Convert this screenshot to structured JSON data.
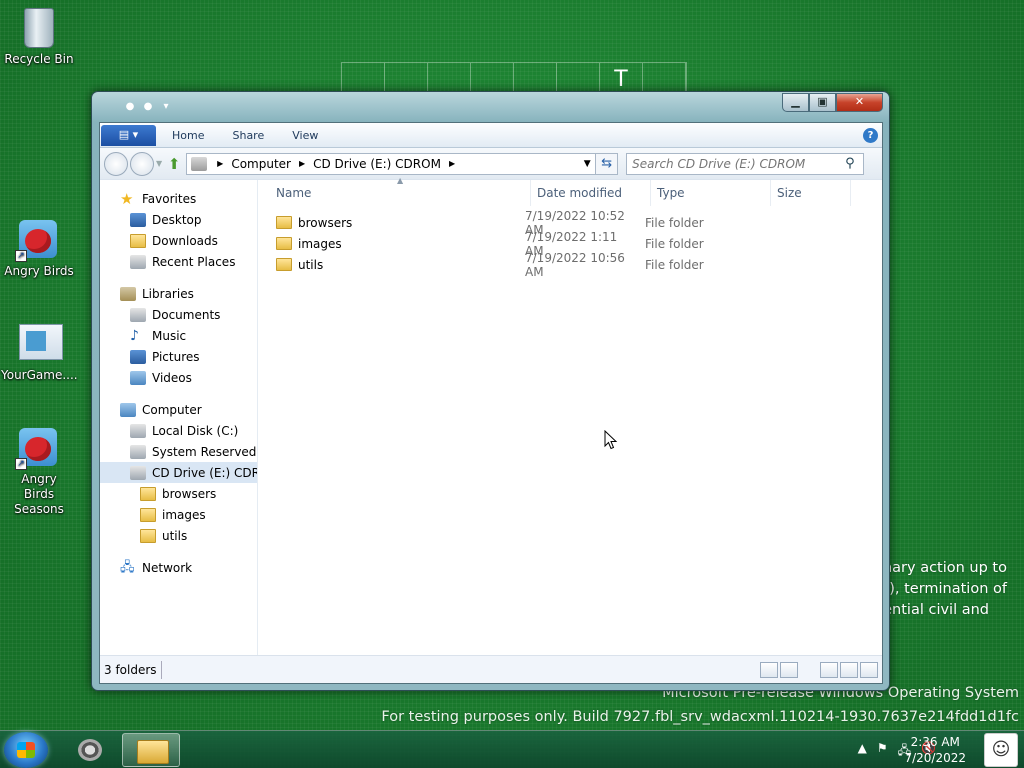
{
  "desktop": {
    "icons": [
      {
        "label": "Recycle Bin"
      },
      {
        "label": "Angry Birds"
      },
      {
        "label": "YourGame...."
      },
      {
        "label": "Angry Birds Seasons"
      }
    ],
    "background_letters": [
      "",
      "",
      "",
      "",
      "",
      "",
      "T",
      ""
    ],
    "notice_lines": [
      "linary action up to",
      "es), termination of",
      "tential civil and"
    ],
    "watermark": {
      "line1": "Microsoft Pre-release Windows Operating System",
      "line2": "For testing purposes only. Build 7927.fbl_srv_wdacxml.110214-1930.7637e214fdd1d1fc"
    }
  },
  "window": {
    "ribbon": {
      "file_label": "▤ ▾",
      "tabs": [
        "Home",
        "Share",
        "View"
      ],
      "help": "?"
    },
    "address": {
      "crumbs": [
        "Computer",
        "CD Drive (E:) CDROM"
      ],
      "search_placeholder": "Search CD Drive (E:) CDROM"
    },
    "nav": {
      "favorites": {
        "label": "Favorites",
        "items": [
          "Desktop",
          "Downloads",
          "Recent Places"
        ]
      },
      "libraries": {
        "label": "Libraries",
        "items": [
          "Documents",
          "Music",
          "Pictures",
          "Videos"
        ]
      },
      "computer": {
        "label": "Computer",
        "items": [
          "Local Disk (C:)",
          "System Reserved (D:",
          "CD Drive (E:) CDROM"
        ]
      },
      "cd_children": [
        "browsers",
        "images",
        "utils"
      ],
      "network": {
        "label": "Network"
      }
    },
    "columns": [
      "Name",
      "Date modified",
      "Type",
      "Size"
    ],
    "files": [
      {
        "name": "browsers",
        "date": "7/19/2022 10:52 AM",
        "type": "File folder"
      },
      {
        "name": "images",
        "date": "7/19/2022 1:11 AM",
        "type": "File folder"
      },
      {
        "name": "utils",
        "date": "7/19/2022 10:56 AM",
        "type": "File folder"
      }
    ],
    "status": {
      "count": "3 folders"
    }
  },
  "taskbar": {
    "clock": {
      "time": "2:36 AM",
      "date": "7/20/2022"
    }
  },
  "colors": {
    "desktop_bg": "#1b7a2e",
    "window_frame": "#87b3bd",
    "selection": "#d9e6f4",
    "close_button": "#c7432a"
  },
  "icons": [
    "recycle-bin-icon",
    "angry-birds-icon",
    "yourgame-icon",
    "start-orb-icon",
    "raccoon-icon",
    "explorer-icon",
    "flag-icon",
    "network-icon",
    "volume-muted-icon",
    "user-avatar-icon"
  ]
}
